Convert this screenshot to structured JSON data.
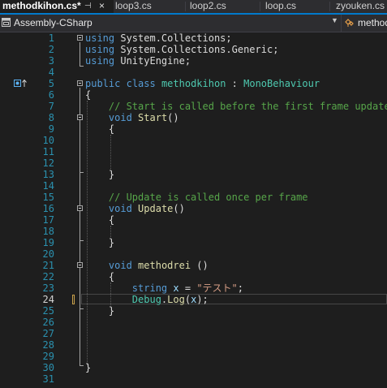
{
  "tabs": [
    {
      "label": "methodkihon.cs*",
      "active": true
    },
    {
      "label": "loop3.cs"
    },
    {
      "label": "loop2.cs"
    },
    {
      "label": "loop.cs"
    },
    {
      "label": "zyouken.cs"
    }
  ],
  "tab_pin_glyph": "⊣",
  "tab_close_glyph": "×",
  "navbar": {
    "project": "Assembly-CSharp",
    "dropdown_glyph": "▼",
    "member": "methodkihon"
  },
  "editor": {
    "current_line": 24,
    "line_numbers": [
      "1",
      "2",
      "3",
      "4",
      "5",
      "6",
      "7",
      "8",
      "9",
      "10",
      "11",
      "12",
      "13",
      "14",
      "15",
      "16",
      "17",
      "18",
      "19",
      "20",
      "21",
      "22",
      "23",
      "24",
      "25",
      "26",
      "27",
      "28",
      "29",
      "30",
      "31"
    ],
    "lines": [
      [
        {
          "t": "using",
          "c": "kw"
        },
        {
          "t": " System.Collections;",
          "c": ""
        }
      ],
      [
        {
          "t": "using",
          "c": "kw"
        },
        {
          "t": " System.Collections.Generic;",
          "c": ""
        }
      ],
      [
        {
          "t": "using",
          "c": "kw"
        },
        {
          "t": " UnityEngine;",
          "c": ""
        }
      ],
      [],
      [
        {
          "t": "public",
          "c": "kw"
        },
        {
          "t": " ",
          "c": ""
        },
        {
          "t": "class",
          "c": "kw"
        },
        {
          "t": " ",
          "c": ""
        },
        {
          "t": "methodkihon",
          "c": "cls"
        },
        {
          "t": " : ",
          "c": ""
        },
        {
          "t": "MonoBehaviour",
          "c": "cls"
        }
      ],
      [
        {
          "t": "{",
          "c": ""
        }
      ],
      [
        {
          "t": "    // Start is called before the first frame update",
          "c": "cmt"
        }
      ],
      [
        {
          "t": "    ",
          "c": ""
        },
        {
          "t": "void",
          "c": "kw"
        },
        {
          "t": " ",
          "c": ""
        },
        {
          "t": "Start",
          "c": "mth"
        },
        {
          "t": "()",
          "c": ""
        }
      ],
      [
        {
          "t": "    {",
          "c": ""
        }
      ],
      [],
      [],
      [],
      [
        {
          "t": "    }",
          "c": ""
        }
      ],
      [],
      [
        {
          "t": "    // Update is called once per frame",
          "c": "cmt"
        }
      ],
      [
        {
          "t": "    ",
          "c": ""
        },
        {
          "t": "void",
          "c": "kw"
        },
        {
          "t": " ",
          "c": ""
        },
        {
          "t": "Update",
          "c": "mth"
        },
        {
          "t": "()",
          "c": ""
        }
      ],
      [
        {
          "t": "    {",
          "c": ""
        }
      ],
      [],
      [
        {
          "t": "    }",
          "c": ""
        }
      ],
      [],
      [
        {
          "t": "    ",
          "c": ""
        },
        {
          "t": "void",
          "c": "kw"
        },
        {
          "t": " ",
          "c": ""
        },
        {
          "t": "methodrei",
          "c": "mth"
        },
        {
          "t": " ()",
          "c": ""
        }
      ],
      [
        {
          "t": "    {",
          "c": ""
        }
      ],
      [
        {
          "t": "        ",
          "c": ""
        },
        {
          "t": "string",
          "c": "kw"
        },
        {
          "t": " ",
          "c": ""
        },
        {
          "t": "x",
          "c": "var"
        },
        {
          "t": " = ",
          "c": ""
        },
        {
          "t": "\"テスト\"",
          "c": "str"
        },
        {
          "t": ";",
          "c": ""
        }
      ],
      [
        {
          "t": "        ",
          "c": ""
        },
        {
          "t": "Debug",
          "c": "cls"
        },
        {
          "t": ".",
          "c": ""
        },
        {
          "t": "Log",
          "c": "mth"
        },
        {
          "t": "(",
          "c": ""
        },
        {
          "t": "x",
          "c": "var"
        },
        {
          "t": ");",
          "c": ""
        }
      ],
      [
        {
          "t": "    }",
          "c": ""
        }
      ],
      [],
      [],
      [],
      [],
      [
        {
          "t": "}",
          "c": ""
        }
      ],
      []
    ]
  },
  "colors": {
    "background": "#1e1e1e",
    "accent": "#007acc",
    "line_number": "#2b91af",
    "keyword": "#569cd6",
    "type": "#4ec9b0",
    "comment": "#57a64a",
    "string": "#d69d85",
    "method": "#dcdcaa",
    "variable": "#9cdcfe"
  },
  "icons": {
    "project": "csharp-project-icon",
    "member": "class-member-icon",
    "codelens": "implements-indicator-icon"
  }
}
